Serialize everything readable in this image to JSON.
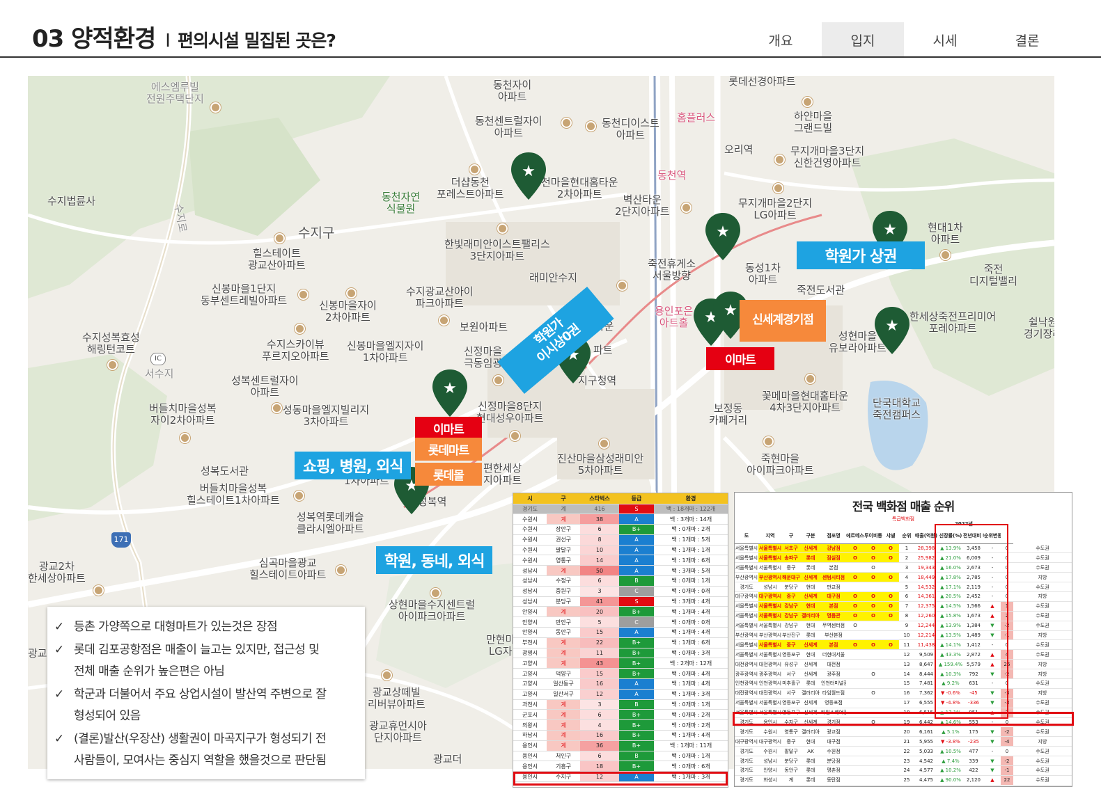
{
  "header": {
    "title": "03 양적환경",
    "separator": "I",
    "subtitle": "편의시설 밀집된 곳은?",
    "tabs": [
      "개요",
      "입지",
      "시세",
      "결론"
    ],
    "active_tab": "입지"
  },
  "map": {
    "places": {
      "p1": "에스엠루빌\n전원주택단지",
      "p2": "동천자이\n아파트",
      "p3": "롯데선경아파트",
      "p4": "동천센트럴자이\n아파트",
      "p5": "동천디이스트\n아파트",
      "p6": "홈플러스",
      "p7": "하얀마을\n그랜드빌",
      "p8": "오리역",
      "p9": "무지개마을3단지\n신한건영아파트",
      "p10": "수지법륜사",
      "p11": "동천자연\n식물원",
      "p12": "더샵동천\n포레스트아파트",
      "p13": "천마을현대홈타운\n2차아파트",
      "p14": "동천역",
      "p15": "벽산타운\n2단지아파트",
      "p16": "무지개마을2단지\nLG아파트",
      "p17": "현대1차\n아파트",
      "p18": "수지구",
      "p19": "힐스테이트\n광교산아파트",
      "p20": "한빛래미안이스트팰리스\n3단지아파트",
      "p21": "죽전휴게소\n서울방향",
      "p22": "동성1차\n아파트",
      "p23": "죽전\n디지털밸리",
      "p24": "신봉마을1단지\n동부센트레빌아파트",
      "p25": "신봉마을자이\n2차아파트",
      "p26": "수지광교산아이\n파크아파트",
      "p27": "래미안수지",
      "p28": "죽전도서관",
      "p29": "용인포은\n아트홀",
      "p30": "보원아파트",
      "p31": "성현마을\n유보라아파트",
      "p32": "한세상죽전프리미어\n포레아파트",
      "p33": "쉴낙원\n경기장례",
      "p34": "수지성복효성\n해링턴코트",
      "p35": "수지스카이뷰\n푸르지오아파트",
      "p36": "신봉마을엘지자이\n1차아파트",
      "p37": "신정마을\n극동임광",
      "p38": "서수지",
      "p39": "지구청역",
      "p40": "성복센트럴자이\n아파트",
      "p41": "버들치마을성복\n자이2차아파트",
      "p42": "성동마을엘지빌리지\n3차아파트",
      "p43": "신정마을8단지\n현대성우아파트",
      "p44": "꽃메마을현대홈타운\n4차3단지아파트",
      "p45": "보정동\n카페거리",
      "p46": "단국대학교\n죽전캠퍼스",
      "p47": "성복도서관",
      "p48": "진산마을삼성래미안\n5차아파트",
      "p49": "죽현마을\n아이파크아파트",
      "p50": "버들치마을성복\n힐스테이트1차아파트",
      "p51": "성복역롯데캐슬\n클라시엘아파트",
      "p52": "성복역",
      "p53": "편한세상\n지아파트",
      "p54": "1차아파트",
      "p55": "광교2차\n한세상아파트",
      "p56": "심곡마을광교\n힐스테이트아파트",
      "p57": "상현마을수지센트럴\n아이파크아파트",
      "p58": "만현마\nLG자",
      "p59": "광교상떼빌\n리버뷰아파트",
      "p60": "광교휴먼시아\n단지아파트",
      "p61": "광교더",
      "p62": "광교",
      "p63": "식타운",
      "p64": "파트",
      "p65": "수지로",
      "p66": "171",
      "p67": "IC"
    },
    "tags": {
      "academy_blue": "학원가 상권",
      "diag_blue": "학원가\n이시상0권",
      "shop_blue": "쇼핑, 병원, 외식",
      "school_blue": "학원, 동네, 외식",
      "shinsegae": "신세계경기점",
      "emart1": "이마트",
      "emart2": "이마트",
      "lottemart": "롯데마트",
      "lottemall": "롯데몰"
    }
  },
  "notes": [
    "등촌 가양쪽으로 대형마트가 있는것은 장점",
    "롯데 김포공항점은 매출이 늘고는 있지만, 접근성 및\n전체 매출 순위가 높은편은 아님",
    "학군과 더불어서 주요 상업시설이 발산역 주변으로 잘\n형성되어 있음",
    "(결론)발산(우장산) 생활권이 마곡지구가 형성되기 전\n사람들이, 모여사는 중심지 역할을 했을것으로 판단됨"
  ],
  "check_mark": "✓",
  "table1": {
    "headers": [
      "시",
      "구",
      "스타벅스",
      "등급",
      "환경"
    ],
    "rows": [
      [
        "경기도",
        "계",
        "416",
        "S",
        "백 : 18개마 : 122개"
      ],
      [
        "수원시",
        "계",
        "38",
        "A",
        "백 : 3개마 : 14개"
      ],
      [
        "수원시",
        "장안구",
        "6",
        "B+",
        "백 : 0개마 : 2개"
      ],
      [
        "수원시",
        "권선구",
        "8",
        "A",
        "백 : 1개마 : 5개"
      ],
      [
        "수원시",
        "팔달구",
        "10",
        "A",
        "백 : 1개마 : 1개"
      ],
      [
        "수원시",
        "영통구",
        "14",
        "A",
        "백 : 1개마 : 6개"
      ],
      [
        "성남시",
        "계",
        "50",
        "A",
        "백 : 3개마 : 5개"
      ],
      [
        "성남시",
        "수정구",
        "6",
        "B",
        "백 : 0개마 : 1개"
      ],
      [
        "성남시",
        "중원구",
        "3",
        "C",
        "백 : 0개마 : 0개"
      ],
      [
        "성남시",
        "분당구",
        "41",
        "S",
        "백 : 3개마 : 4개"
      ],
      [
        "안양시",
        "계",
        "20",
        "B+",
        "백 : 1개마 : 4개"
      ],
      [
        "안양시",
        "만안구",
        "5",
        "C",
        "백 : 0개마 : 0개"
      ],
      [
        "안양시",
        "동안구",
        "15",
        "A",
        "백 : 1개마 : 4개"
      ],
      [
        "부천시",
        "계",
        "22",
        "B+",
        "백 : 1개마 : 6개"
      ],
      [
        "광명시",
        "계",
        "11",
        "B+",
        "백 : 0개마 : 3개"
      ],
      [
        "고양시",
        "계",
        "43",
        "B+",
        "백 : 2개마 : 12개"
      ],
      [
        "고양시",
        "덕양구",
        "15",
        "B+",
        "백 : 0개마 : 4개"
      ],
      [
        "고양시",
        "일산동구",
        "16",
        "A",
        "백 : 1개마 : 4개"
      ],
      [
        "고양시",
        "일산서구",
        "12",
        "A",
        "백 : 1개마 : 3개"
      ],
      [
        "과천시",
        "계",
        "3",
        "B",
        "백 : 0개마 : 1개"
      ],
      [
        "군포시",
        "계",
        "6",
        "B+",
        "백 : 0개마 : 2개"
      ],
      [
        "의왕시",
        "계",
        "4",
        "B+",
        "백 : 0개마 : 2개"
      ],
      [
        "하남시",
        "계",
        "16",
        "B+",
        "백 : 1개마 : 4개"
      ],
      [
        "용인시",
        "계",
        "36",
        "B+",
        "백 : 1개마 : 11개"
      ],
      [
        "용인시",
        "처인구",
        "6",
        "B",
        "백 : 0개마 : 1개"
      ],
      [
        "용인시",
        "기흥구",
        "18",
        "B+",
        "백 : 0개마 : 6개"
      ],
      [
        "용인시",
        "수지구",
        "12",
        "A",
        "백 : 1개마 : 3개"
      ]
    ],
    "colors": {
      "S": "#e10c12",
      "A": "#1b7fd0",
      "B+": "#1e9a3a",
      "B": "#1e9a3a",
      "C": "#9e9e9e"
    }
  },
  "table2": {
    "title": "전국 백화점 매출 순위",
    "subtitle": "특급백화점",
    "headers": [
      "도",
      "지역",
      "구",
      "구분",
      "점포명",
      "에르메스",
      "루이비통",
      "샤넬",
      "순위",
      "매출(억원)",
      "신장률(%)",
      "전년대비 매출 증",
      "순위변동",
      ""
    ],
    "year": "2022년",
    "rows": [
      [
        "서울특별시",
        "서울특별시",
        "서초구",
        "신세계",
        "강남점",
        "O",
        "O",
        "O",
        "1",
        "28,398",
        "▲ 13.9%",
        "3,458",
        "-",
        "0",
        "수도권",
        "y"
      ],
      [
        "서울특별시",
        "서울특별시",
        "송파구",
        "롯데",
        "잠실점",
        "O",
        "O",
        "O",
        "2",
        "25,982",
        "▲ 21.0%",
        "6,009",
        "-",
        "0",
        "수도권",
        "y"
      ],
      [
        "서울특별시",
        "서울특별시",
        "중구",
        "롯데",
        "본점",
        "",
        "O",
        "",
        "3",
        "19,343",
        "▲ 16.0%",
        "2,673",
        "-",
        "0",
        "수도권",
        ""
      ],
      [
        "부산광역시",
        "부산광역시",
        "해운대구",
        "신세계",
        "센텀시티점",
        "O",
        "O",
        "O",
        "4",
        "18,449",
        "▲ 17.8%",
        "2,785",
        "-",
        "0",
        "지방",
        "y"
      ],
      [
        "경기도",
        "성남시",
        "분당구",
        "현대",
        "판교점",
        "",
        "",
        "",
        "5",
        "14,532",
        "▲ 17.1%",
        "2,119",
        "-",
        "0",
        "수도권",
        ""
      ],
      [
        "대구광역시",
        "대구광역시",
        "중구",
        "신세계",
        "대구점",
        "O",
        "O",
        "O",
        "6",
        "14,361",
        "▲ 20.5%",
        "2,452",
        "-",
        "0",
        "지방",
        "y"
      ],
      [
        "서울특별시",
        "서울특별시",
        "강남구",
        "현대",
        "본점",
        "O",
        "O",
        "O",
        "7",
        "12,375",
        "▲ 14.5%",
        "1,566",
        "▲",
        "1",
        "수도권",
        "y"
      ],
      [
        "서울특별시",
        "서울특별시",
        "강남구",
        "갤러리아",
        "명품관",
        "O",
        "O",
        "O",
        "8",
        "12,260",
        "▲ 15.8%",
        "1,673",
        "▲",
        "2",
        "수도권",
        "y"
      ],
      [
        "서울특별시",
        "서울특별시",
        "강남구",
        "현대",
        "무역센터점",
        "O",
        "",
        "",
        "9",
        "12,244",
        "▲ 13.9%",
        "1,384",
        "▼",
        "-2",
        "수도권",
        ""
      ],
      [
        "부산광역시",
        "부산광역시",
        "부산진구",
        "롯데",
        "부산본점",
        "",
        "",
        "",
        "10",
        "12,214",
        "▲ 13.5%",
        "1,489",
        "▼",
        "-1",
        "지방",
        ""
      ],
      [
        "서울특별시",
        "서울특별시",
        "중구",
        "신세계",
        "본점",
        "O",
        "O",
        "O",
        "11",
        "11,438",
        "▲ 14.1%",
        "1,412",
        "-",
        "0",
        "수도권",
        "y"
      ],
      [
        "서울특별시",
        "서울특별시",
        "영등포구",
        "현대",
        "더현대서울",
        "",
        "",
        "",
        "12",
        "9,509",
        "▲ 43.3%",
        "2,872",
        "▲",
        "4",
        "수도권",
        ""
      ],
      [
        "대전광역시",
        "대전광역시",
        "유성구",
        "신세계",
        "대전점",
        "",
        "",
        "",
        "13",
        "8,647",
        "▲ 159.4%",
        "5,579",
        "▲",
        "26",
        "지방",
        ""
      ],
      [
        "광주광역시",
        "광주광역시",
        "서구",
        "신세계",
        "광주점",
        "",
        "O",
        "",
        "14",
        "8,444",
        "▲ 10.3%",
        "792",
        "▼",
        "-2",
        "지방",
        ""
      ],
      [
        "인천광역시",
        "인천광역시",
        "미추홀구",
        "롯데",
        "인천터미널점",
        "",
        "",
        "",
        "15",
        "7,481",
        "▲ 9.2%",
        "631",
        "-",
        "0",
        "수도권",
        ""
      ],
      [
        "대전광역시",
        "대전광역시",
        "서구",
        "갤러리아",
        "타임월드점",
        "",
        "O",
        "",
        "16",
        "7,362",
        "▼ -0.6%",
        "-45",
        "▼",
        "-3",
        "지방",
        ""
      ],
      [
        "서울특별시",
        "서울특별시",
        "영등포구",
        "신세계",
        "영등포점",
        "",
        "",
        "",
        "17",
        "6,555",
        "▼ -4.8%",
        "-336",
        "▼",
        "-3",
        "수도권",
        ""
      ],
      [
        "서울특별시",
        "서울특별시",
        "영등포구",
        "신세계",
        "타임스퀘어점",
        "",
        "",
        "",
        "18",
        "6,515",
        "▲ 17.1%",
        "951",
        "▲",
        "2",
        "수도권",
        ""
      ],
      [
        "경기도",
        "용인시",
        "수지구",
        "신세계",
        "경기점",
        "",
        "O",
        "",
        "19",
        "6,442",
        "▲ 14.6%",
        "553",
        "-",
        "0",
        "수도권",
        "hl"
      ],
      [
        "경기도",
        "수원시",
        "영통구",
        "갤러리아",
        "광교점",
        "",
        "",
        "",
        "20",
        "6,161",
        "▲ 5.1%",
        "175",
        "▼",
        "-2",
        "수도권",
        ""
      ],
      [
        "대구광역시",
        "대구광역시",
        "중구",
        "현대",
        "대구점",
        "",
        "",
        "",
        "21",
        "5,955",
        "▼ -3.8%",
        "-235",
        "▼",
        "-4",
        "지방",
        ""
      ],
      [
        "경기도",
        "수원시",
        "팔달구",
        "AK",
        "수원점",
        "",
        "",
        "",
        "22",
        "5,033",
        "▲ 10.5%",
        "477",
        "-",
        "0",
        "수도권",
        ""
      ],
      [
        "경기도",
        "성남시",
        "분당구",
        "롯데",
        "분당점",
        "",
        "",
        "",
        "23",
        "4,542",
        "▲ 7.4%",
        "339",
        "▼",
        "-2",
        "수도권",
        ""
      ],
      [
        "경기도",
        "안양시",
        "동안구",
        "롯데",
        "평촌점",
        "",
        "",
        "",
        "24",
        "4,577",
        "▲ 10.2%",
        "422",
        "▼",
        "-1",
        "수도권",
        ""
      ],
      [
        "경기도",
        "화성시",
        "계",
        "롯데",
        "동탄점",
        "",
        "",
        "",
        "25",
        "4,475",
        "▲ 90.0%",
        "2,120",
        "▲",
        "22",
        "수도권",
        ""
      ]
    ]
  }
}
